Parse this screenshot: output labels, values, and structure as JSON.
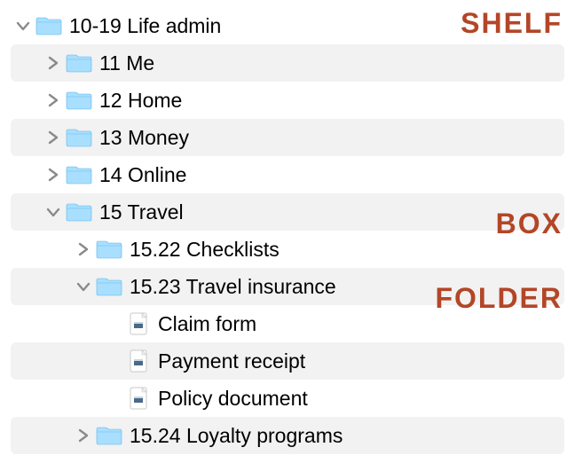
{
  "annotations": {
    "shelf": "SHELF",
    "box": "BOX",
    "folder": "FOLDER"
  },
  "tree": {
    "root": {
      "label": "10-19 Life admin",
      "children": {
        "me": {
          "label": "11 Me"
        },
        "home": {
          "label": "12 Home"
        },
        "money": {
          "label": "13 Money"
        },
        "online": {
          "label": "14 Online"
        },
        "travel": {
          "label": "15 Travel",
          "children": {
            "checklists": {
              "label": "15.22 Checklists"
            },
            "insurance": {
              "label": "15.23 Travel insurance",
              "files": {
                "claim": {
                  "label": "Claim form"
                },
                "receipt": {
                  "label": "Payment receipt"
                },
                "policy": {
                  "label": "Policy document"
                }
              }
            },
            "loyalty": {
              "label": "15.24 Loyalty programs"
            }
          }
        }
      }
    }
  }
}
